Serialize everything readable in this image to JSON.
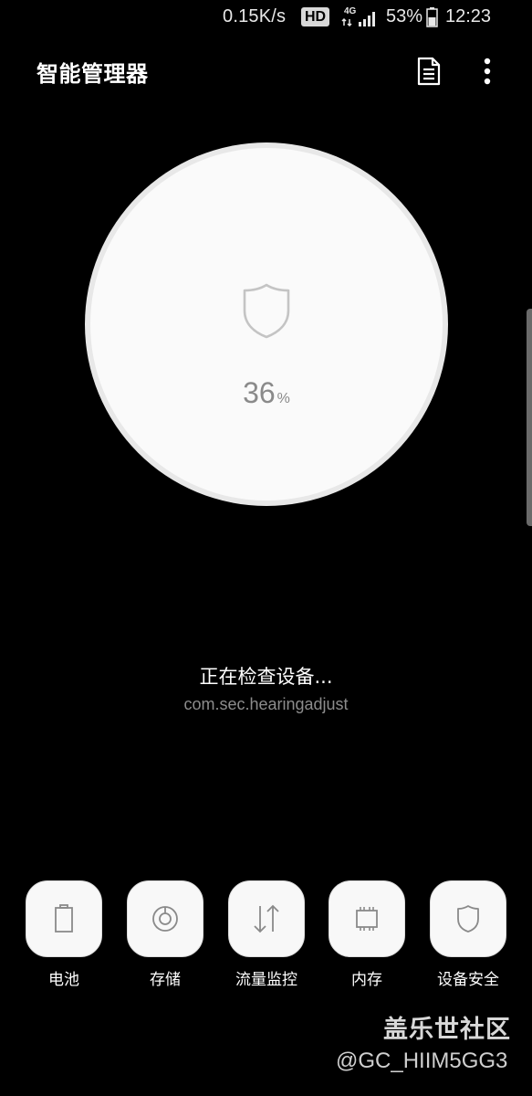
{
  "status_bar": {
    "speed": "0.15K/s",
    "hd": "HD",
    "network": "4G",
    "battery_percent": "53%",
    "battery_level": 0.53,
    "time": "12:23"
  },
  "app_bar": {
    "title": "智能管理器",
    "doc_icon": "document-icon",
    "more_icon": "more-vert-icon"
  },
  "scan": {
    "progress_value": "36",
    "progress_unit": "%",
    "progress_fraction": 0.36,
    "status_text": "正在检查设备...",
    "current_package": "com.sec.hearingadjust",
    "gauge_icon": "shield-icon"
  },
  "tiles": [
    {
      "label": "电池",
      "icon": "battery-icon"
    },
    {
      "label": "存储",
      "icon": "storage-disc-icon"
    },
    {
      "label": "流量监控",
      "icon": "data-transfer-icon"
    },
    {
      "label": "内存",
      "icon": "memory-chip-icon"
    },
    {
      "label": "设备安全",
      "icon": "shield-icon"
    }
  ],
  "watermark": {
    "site": "盖乐世社区",
    "user": "@GC_HIIM5GG3"
  },
  "colors": {
    "background": "#000000",
    "gauge_face": "#fafafa",
    "gauge_ring": "#e8e8e8",
    "icon_gray": "#8a8a8a",
    "text_secondary": "#8c8c8c"
  }
}
